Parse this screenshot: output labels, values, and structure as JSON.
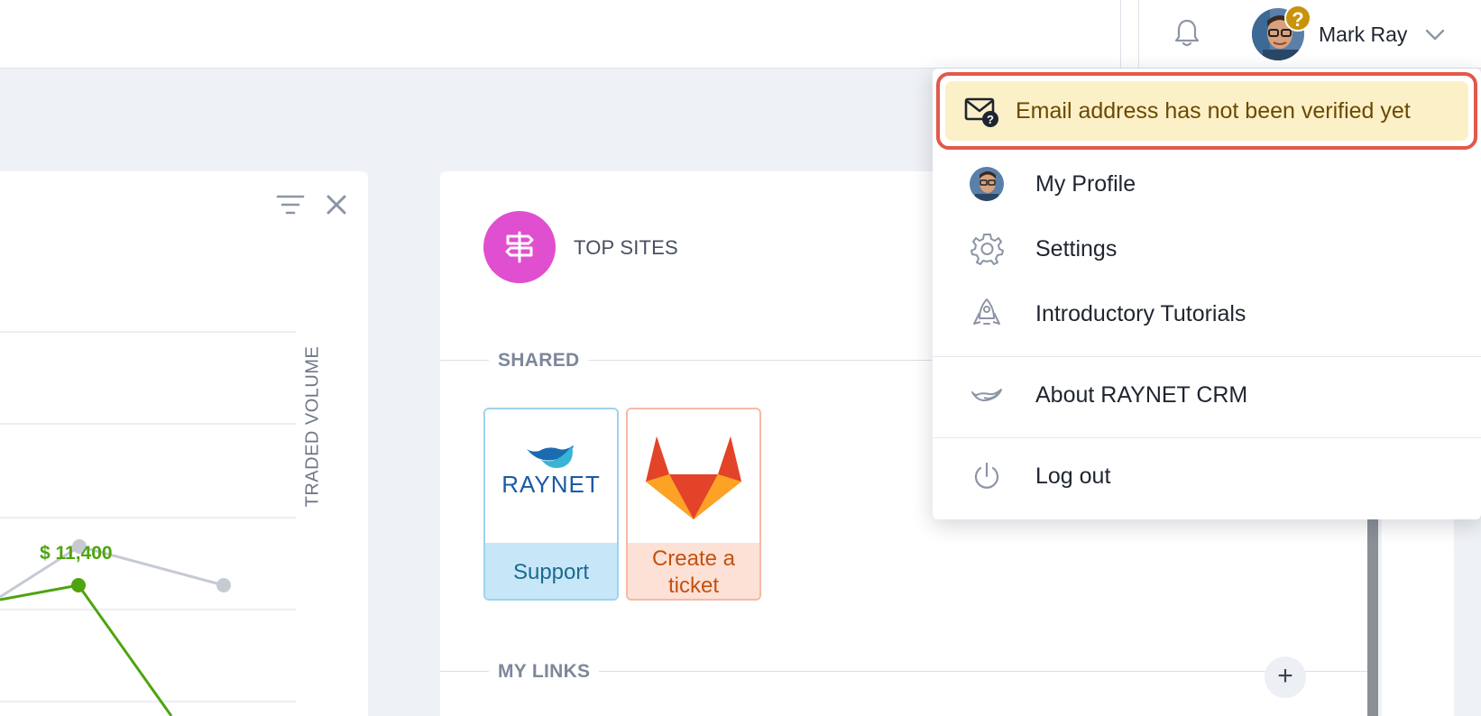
{
  "header": {
    "user_name": "Mark Ray",
    "avatar_badge": "?"
  },
  "widget": {
    "axis_label": "TRADED VOLUME",
    "point_label": "$ 11,400"
  },
  "top_sites": {
    "title": "TOP SITES",
    "shared_label": "SHARED",
    "my_links_label": "MY LINKS",
    "tiles": [
      {
        "label": "Support",
        "logo_text": "RAYNET"
      },
      {
        "label": "Create a ticket"
      }
    ]
  },
  "user_menu": {
    "verify_notice": "Email address has not been verified yet",
    "items": [
      {
        "label": "My Profile",
        "icon": "avatar-icon"
      },
      {
        "label": "Settings",
        "icon": "gear-icon"
      },
      {
        "label": "Introductory Tutorials",
        "icon": "rocket-icon"
      },
      {
        "label": "About RAYNET CRM",
        "icon": "raynet-logo-icon"
      },
      {
        "label": "Log out",
        "icon": "power-icon"
      }
    ]
  },
  "colors": {
    "accent_pink": "#e04fcf",
    "series_green": "#4ea40e",
    "series_gray": "#c5cad3",
    "warning_bg": "#fcf0c8",
    "warning_outline": "#e2594a"
  }
}
